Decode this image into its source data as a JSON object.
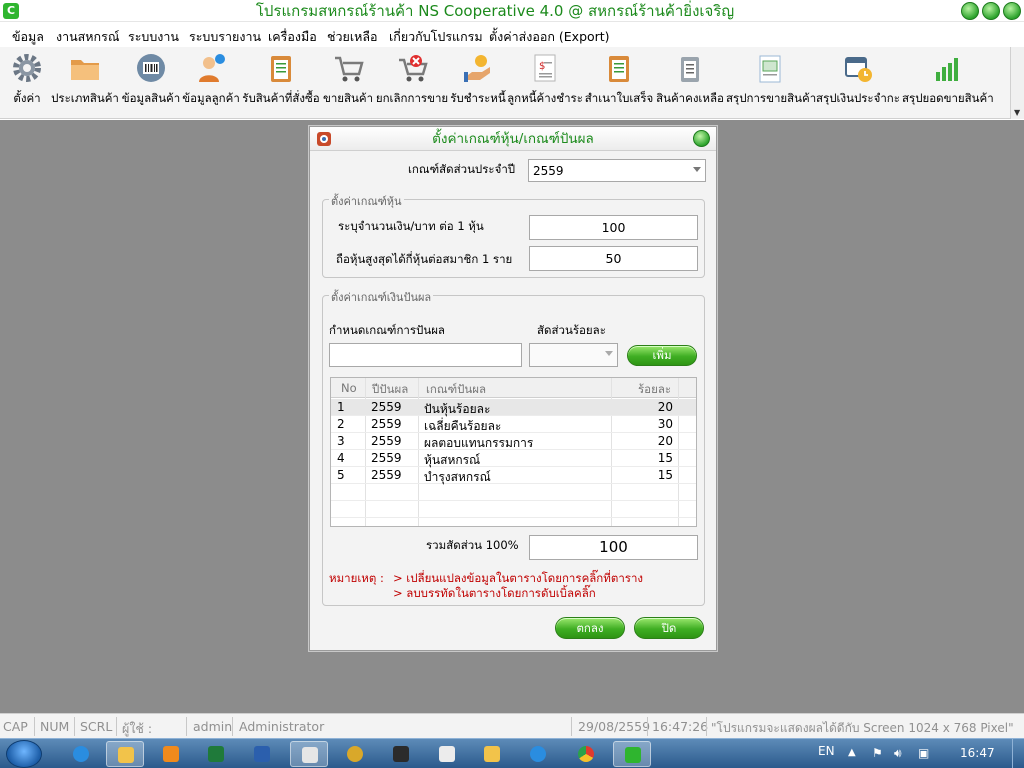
{
  "window": {
    "title": "โปรแกรมสหกรณ์ร้านค้า NS Cooperative 4.0 @ สหกรณ์ร้านค้ายิ่งเจริญ",
    "app_badge": "C",
    "accent": "#1c8a1c"
  },
  "menu": [
    {
      "label": "ข้อมูล"
    },
    {
      "label": "งานสหกรณ์"
    },
    {
      "label": "ระบบงาน"
    },
    {
      "label": "ระบบรายงาน"
    },
    {
      "label": "เครื่องมือ"
    },
    {
      "label": "ช่วยเหลือ"
    },
    {
      "label": "เกี่ยวกับโปรแกรม"
    },
    {
      "label": "ตั้งค่าส่งออก (Export)"
    }
  ],
  "toolbar": [
    {
      "label": "ตั้งค่า",
      "icon": "gear-icon"
    },
    {
      "label": "ประเภทสินค้า",
      "icon": "folder-icon"
    },
    {
      "label": "ข้อมูลสินค้า",
      "icon": "barcode-scanner-icon"
    },
    {
      "label": "ข้อมูลลูกค้า",
      "icon": "customer-icon"
    },
    {
      "label": "รับสินค้าที่สั่งซื้อ",
      "icon": "clipboard-icon"
    },
    {
      "label": "ขายสินค้า",
      "icon": "cart-icon"
    },
    {
      "label": "ยกเลิกการขาย",
      "icon": "cart-cancel-icon"
    },
    {
      "label": "รับชำระหนี้",
      "icon": "payment-icon"
    },
    {
      "label": "ลูกหนี้ค้างชำระ",
      "icon": "invoice-icon"
    },
    {
      "label": "สำเนาใบเสร็จ",
      "icon": "receipt-copy-icon"
    },
    {
      "label": "สินค้าคงเหลือ",
      "icon": "stock-icon"
    },
    {
      "label": "สรุปการขายสินค้า",
      "icon": "sales-report-icon"
    },
    {
      "label": "สรุปเงินประจำกะ",
      "icon": "calendar-clock-icon"
    },
    {
      "label": "สรุปยอดขายสินค้า",
      "icon": "bar-chart-icon"
    }
  ],
  "dialog": {
    "title": "ตั้งค่าเกณฑ์หุ้น/เกณฑ์ปันผล",
    "year_label": "เกณฑ์สัดส่วนประจำปี",
    "year_value": "2559",
    "share_group": {
      "title": "ตั้งค่าเกณฑ์หุ้น",
      "price_label": "ระบุจำนวนเงิน/บาท ต่อ 1 หุ้น",
      "price_value": "100",
      "max_label": "ถือหุ้นสูงสุดได้กี่หุ้นต่อสมาชิก 1 ราย",
      "max_value": "50"
    },
    "dividend_group": {
      "title": "ตั้งค่าเกณฑ์เงินปันผล",
      "criteria_label": "กำหนดเกณฑ์การปันผล",
      "criteria_value": "",
      "percent_label": "สัดส่วนร้อยละ",
      "percent_value": "",
      "add_button": "เพิ่ม",
      "columns": [
        "No",
        "ปีปันผล",
        "เกณฑ์ปันผล",
        "ร้อยละ"
      ],
      "rows": [
        [
          "1",
          "2559",
          "ปันหุ้นร้อยละ",
          "20"
        ],
        [
          "2",
          "2559",
          "เฉลี่ยคืนร้อยละ",
          "30"
        ],
        [
          "3",
          "2559",
          "ผลตอบแทนกรรมการ",
          "20"
        ],
        [
          "4",
          "2559",
          "หุ้นสหกรณ์",
          "15"
        ],
        [
          "5",
          "2559",
          "บำรุงสหกรณ์",
          "15"
        ]
      ],
      "total_label": "รวมสัดส่วน 100%",
      "total_value": "100",
      "note_label": "หมายเหตุ :",
      "note_1": "> เปลี่ยนแปลงข้อมูลในตารางโดยการคลิ๊กที่ตาราง",
      "note_2": "> ลบบรรทัดในตารางโดยการดับเบิ้ลคลิ๊ก"
    },
    "ok_button": "ตกลง",
    "close_button": "ปิด"
  },
  "status": {
    "cap": "CAP",
    "num": "NUM",
    "scrl": "SCRL",
    "user_label": "ผู้ใช้ :",
    "user_id": "admin",
    "user_name": "Administrator",
    "date": "29/08/2559",
    "time": "16:47:26",
    "message": "\"โปรแกรมจะแสดงผลได้ดีกับ Screen 1024 x 768 Pixel\""
  },
  "taskbar": {
    "lang": "EN",
    "clock": "16:47"
  }
}
